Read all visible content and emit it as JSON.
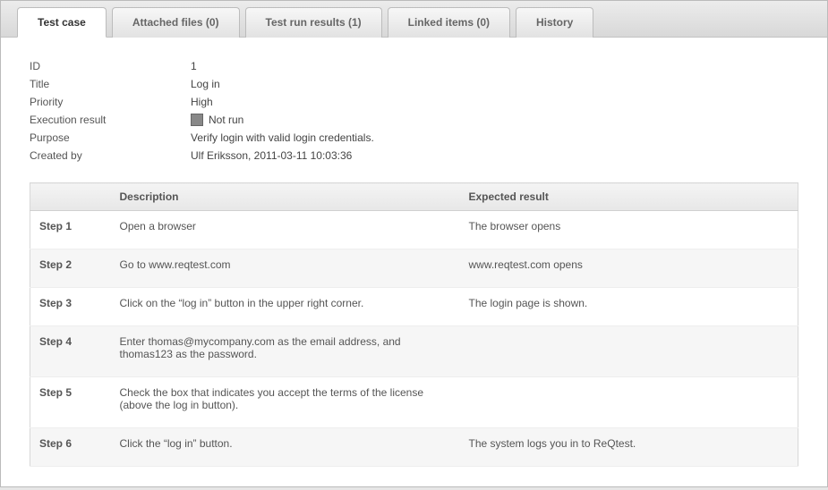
{
  "tabs": [
    {
      "label": "Test case",
      "active": true
    },
    {
      "label": "Attached files (0)",
      "active": false
    },
    {
      "label": "Test run results (1)",
      "active": false
    },
    {
      "label": "Linked items (0)",
      "active": false
    },
    {
      "label": "History",
      "active": false
    }
  ],
  "fields": {
    "id_label": "ID",
    "id_value": "1",
    "title_label": "Title",
    "title_value": "Log in",
    "priority_label": "Priority",
    "priority_value": "High",
    "execution_label": "Execution result",
    "execution_value": "Not run",
    "purpose_label": "Purpose",
    "purpose_value": "Verify login with valid login credentials.",
    "createdby_label": "Created by",
    "createdby_value": "Ulf Eriksson, 2011-03-11 10:03:36"
  },
  "table": {
    "headers": {
      "step": "",
      "description": "Description",
      "expected": "Expected result"
    },
    "rows": [
      {
        "step": "Step 1",
        "description": "Open a browser",
        "expected": "The browser opens"
      },
      {
        "step": "Step 2",
        "description": "Go to www.reqtest.com",
        "expected": "www.reqtest.com opens"
      },
      {
        "step": "Step 3",
        "description": "Click on the “log in” button in the upper right corner.",
        "expected": "The login page is shown."
      },
      {
        "step": "Step 4",
        "description": "Enter thomas@mycompany.com as the email address, and thomas123 as the password.",
        "expected": ""
      },
      {
        "step": "Step 5",
        "description": "Check the box that indicates you accept the terms of the license (above the log in button).",
        "expected": ""
      },
      {
        "step": "Step 6",
        "description": "Click the “log in” button.",
        "expected": "The system logs you in to ReQtest."
      }
    ]
  }
}
